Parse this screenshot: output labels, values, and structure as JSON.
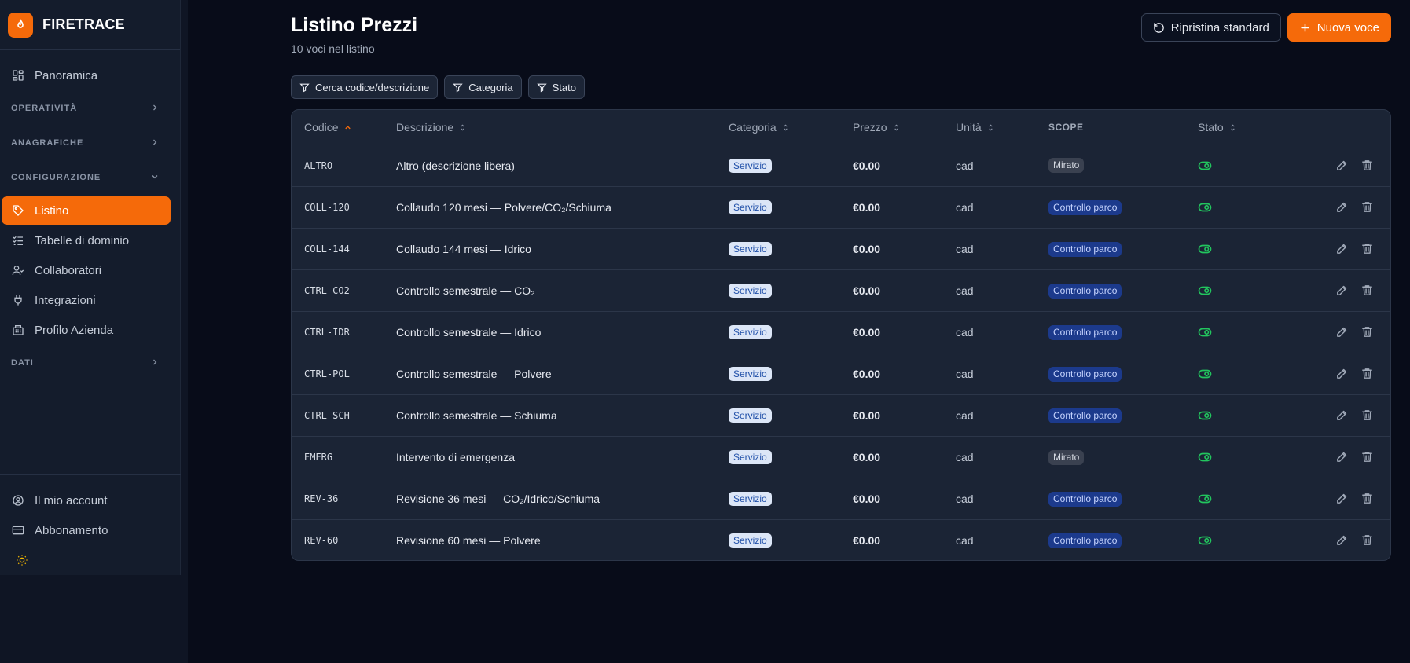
{
  "brand": {
    "name": "FIRETRACE",
    "accent": "#f56a0a"
  },
  "sidebar": {
    "overview": "Panoramica",
    "sections": {
      "operativita": "OPERATIVITÀ",
      "anagrafiche": "ANAGRAFICHE",
      "configurazione": "CONFIGURAZIONE",
      "dati": "DATI"
    },
    "config_items": [
      "Listino",
      "Tabelle di dominio",
      "Collaboratori",
      "Integrazioni",
      "Profilo Azienda"
    ],
    "footer": {
      "account": "Il mio account",
      "subscription": "Abbonamento"
    }
  },
  "header": {
    "title": "Listino Prezzi",
    "subtitle": "10 voci nel listino",
    "reset_label": "Ripristina standard",
    "new_label": "Nuova voce"
  },
  "filters": {
    "search": "Cerca codice/descrizione",
    "category": "Categoria",
    "status": "Stato"
  },
  "table": {
    "columns": {
      "code": "Codice",
      "description": "Descrizione",
      "category": "Categoria",
      "price": "Prezzo",
      "unit": "Unità",
      "scope": "SCOPE",
      "status": "Stato"
    },
    "rows": [
      {
        "code": "ALTRO",
        "description": "Altro (descrizione libera)",
        "category": "Servizio",
        "price": "€0.00",
        "unit": "cad",
        "scope": "Mirato"
      },
      {
        "code": "COLL-120",
        "description": "Collaudo 120 mesi — Polvere/CO₂/Schiuma",
        "category": "Servizio",
        "price": "€0.00",
        "unit": "cad",
        "scope": "Controllo parco"
      },
      {
        "code": "COLL-144",
        "description": "Collaudo 144 mesi — Idrico",
        "category": "Servizio",
        "price": "€0.00",
        "unit": "cad",
        "scope": "Controllo parco"
      },
      {
        "code": "CTRL-CO2",
        "description": "Controllo semestrale — CO₂",
        "category": "Servizio",
        "price": "€0.00",
        "unit": "cad",
        "scope": "Controllo parco"
      },
      {
        "code": "CTRL-IDR",
        "description": "Controllo semestrale — Idrico",
        "category": "Servizio",
        "price": "€0.00",
        "unit": "cad",
        "scope": "Controllo parco"
      },
      {
        "code": "CTRL-POL",
        "description": "Controllo semestrale — Polvere",
        "category": "Servizio",
        "price": "€0.00",
        "unit": "cad",
        "scope": "Controllo parco"
      },
      {
        "code": "CTRL-SCH",
        "description": "Controllo semestrale — Schiuma",
        "category": "Servizio",
        "price": "€0.00",
        "unit": "cad",
        "scope": "Controllo parco"
      },
      {
        "code": "EMERG",
        "description": "Intervento di emergenza",
        "category": "Servizio",
        "price": "€0.00",
        "unit": "cad",
        "scope": "Mirato"
      },
      {
        "code": "REV-36",
        "description": "Revisione 36 mesi — CO₂/Idrico/Schiuma",
        "category": "Servizio",
        "price": "€0.00",
        "unit": "cad",
        "scope": "Controllo parco"
      },
      {
        "code": "REV-60",
        "description": "Revisione 60 mesi — Polvere",
        "category": "Servizio",
        "price": "€0.00",
        "unit": "cad",
        "scope": "Controllo parco"
      }
    ]
  }
}
